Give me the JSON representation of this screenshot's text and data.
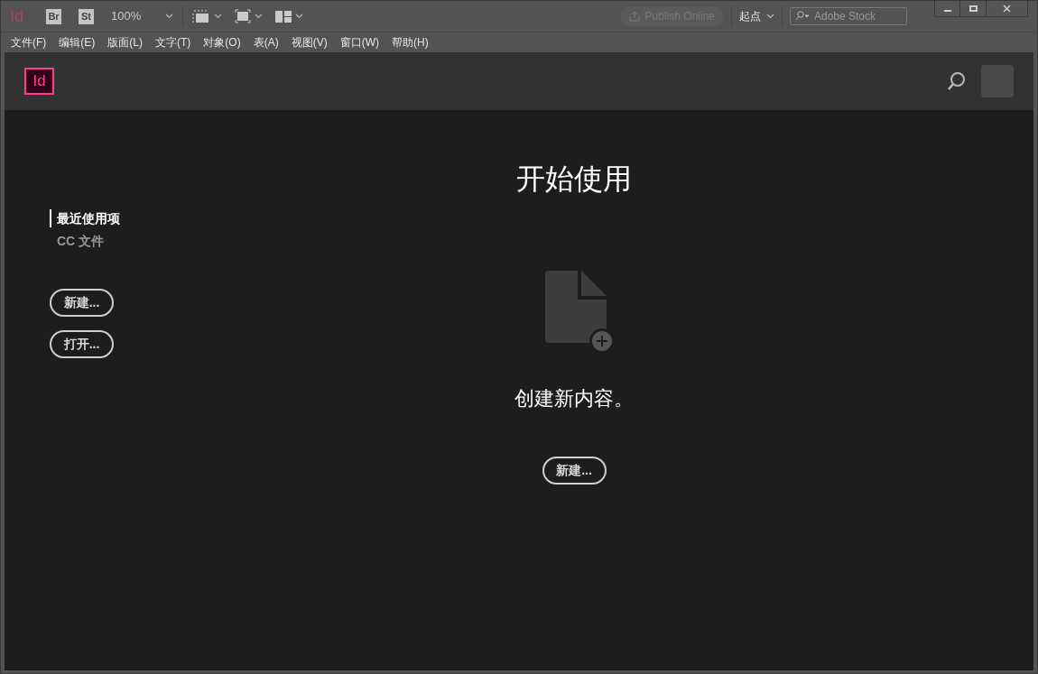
{
  "app_bar": {
    "logo": "Id",
    "apps": [
      "Br",
      "St"
    ],
    "zoom": "100%",
    "publish": {
      "label": "Publish Online",
      "disabled": true
    },
    "workspace": "起点",
    "search": {
      "placeholder": "Adobe Stock"
    }
  },
  "menu": [
    "文件(F)",
    "编辑(E)",
    "版面(L)",
    "文字(T)",
    "对象(O)",
    "表(A)",
    "视图(V)",
    "窗口(W)",
    "帮助(H)"
  ],
  "home": {
    "logo": "Id",
    "sidebar": {
      "items": [
        {
          "label": "最近使用项",
          "selected": true
        },
        {
          "label": "CC 文件",
          "selected": false
        }
      ],
      "buttons": [
        "新建...",
        "打开..."
      ]
    },
    "main": {
      "title": "开始使用",
      "caption": "创建新内容。",
      "button": "新建..."
    }
  }
}
